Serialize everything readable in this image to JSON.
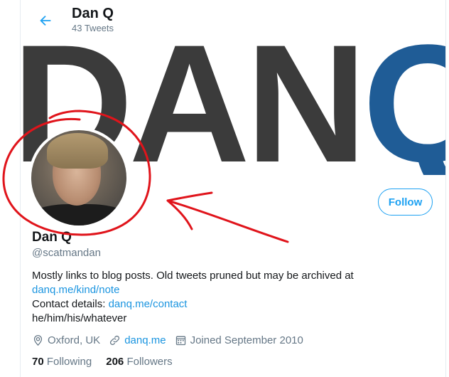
{
  "header": {
    "title": "Dan Q",
    "tweet_count": "43 Tweets"
  },
  "banner": {
    "word_dark": "DAN",
    "word_blue": "Q",
    "colors": {
      "dark": "#3b3b3b",
      "blue": "#1f5c96"
    }
  },
  "profile": {
    "name": "Dan Q",
    "handle": "@scatmandan",
    "follow_label": "Follow",
    "bio": {
      "line1": "Mostly links to blog posts. Old tweets pruned but may be archived at",
      "link1": "danq.me/kind/note",
      "contact_prefix": "Contact details: ",
      "link2": "danq.me/contact",
      "pronouns": "he/him/his/whatever"
    },
    "location": "Oxford, UK",
    "website": "danq.me",
    "joined": "Joined September 2010",
    "following_count": "70",
    "following_label": "Following",
    "followers_count": "206",
    "followers_label": "Followers"
  },
  "icons": {
    "back": "arrow-left-icon",
    "location": "location-pin-icon",
    "website": "link-icon",
    "joined": "calendar-icon"
  },
  "colors": {
    "accent": "#1da1f2",
    "link": "#1b95e0",
    "muted": "#657786",
    "annotation": "#e0141b"
  }
}
